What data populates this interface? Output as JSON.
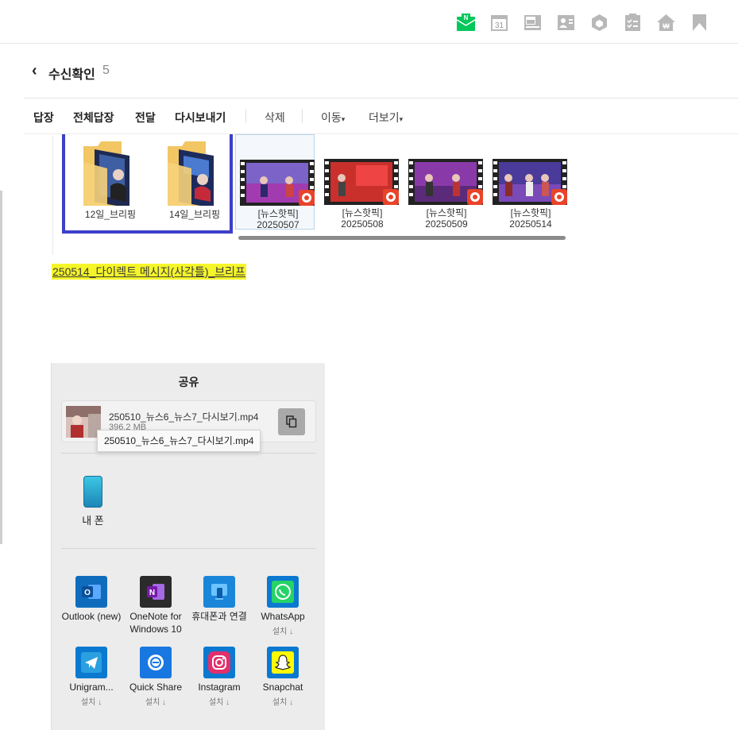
{
  "topbar": {
    "icons": [
      "mail-icon",
      "calendar-icon",
      "photo-icon",
      "contacts-icon",
      "box-icon",
      "todo-icon",
      "home-icon",
      "bookmark-icon"
    ],
    "calendar_day": "31",
    "mail_badge": "N",
    "accent": "#03c75a"
  },
  "header": {
    "back": "‹",
    "title": "수신확인",
    "count": "5"
  },
  "toolbar": {
    "reply": "답장",
    "reply_all": "전체답장",
    "forward": "전달",
    "resend": "다시보내기",
    "delete": "삭제",
    "move": "이동",
    "more": "더보기",
    "caret": "▾"
  },
  "attachments": {
    "folders": [
      {
        "label": "12일_브리핑"
      },
      {
        "label": "14일_브리핑"
      }
    ],
    "videos": [
      {
        "line1": "[뉴스핫픽]",
        "line2": "20250507"
      },
      {
        "line1": "[뉴스핫픽]",
        "line2": "20250508"
      },
      {
        "line1": "[뉴스핫픽]",
        "line2": "20250509"
      },
      {
        "line1": "[뉴스핫픽]",
        "line2": "20250514"
      }
    ],
    "selection_color": "#3b40c8"
  },
  "highlight_link": "250514_다이렉트 메시지(사각틀)_브리프",
  "share": {
    "title": "공유",
    "file_name": "250510_뉴스6_뉴스7_다시보기.mp4",
    "file_size": "396.2 MB",
    "tooltip": "250510_뉴스6_뉴스7_다시보기.mp4",
    "device_label": "내 폰",
    "apps_row1": [
      {
        "name": "Outlook (new)",
        "install": ""
      },
      {
        "name": "OneNote for Windows 10",
        "install": ""
      },
      {
        "name": "휴대폰과 연결",
        "install": ""
      },
      {
        "name": "WhatsApp",
        "install": "설치 ↓"
      }
    ],
    "apps_row2": [
      {
        "name": "Unigram...",
        "install": "설치 ↓"
      },
      {
        "name": "Quick Share",
        "install": "설치 ↓"
      },
      {
        "name": "Instagram",
        "install": "설치 ↓"
      },
      {
        "name": "Snapchat",
        "install": "설치 ↓"
      }
    ]
  }
}
